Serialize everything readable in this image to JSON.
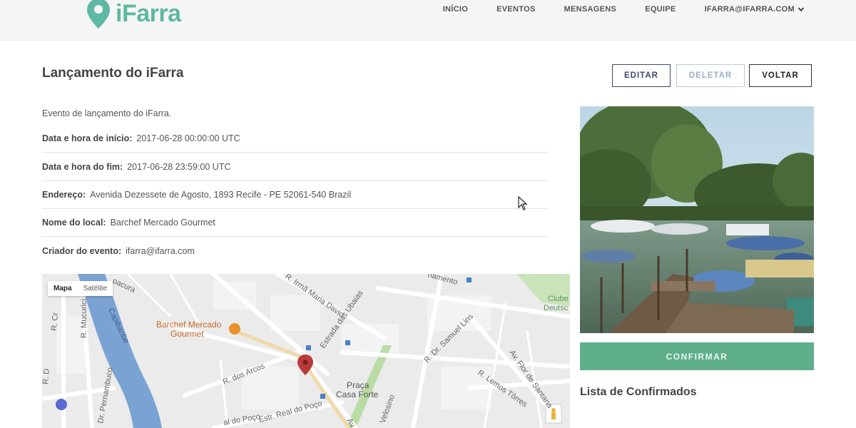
{
  "brand": {
    "name": "iFarra",
    "color": "#5fb8a3"
  },
  "nav": {
    "items": [
      "INÍCIO",
      "EVENTOS",
      "MENSAGENS",
      "EQUIPE"
    ],
    "account": "IFARRA@IFARRA.COM"
  },
  "event": {
    "title": "Lançamento do iFarra",
    "description": "Evento de lançamento do iFarra.",
    "fields": [
      {
        "label": "Data e hora de início:",
        "value": "2017-06-28 00:00:00 UTC"
      },
      {
        "label": "Data e hora do fim:",
        "value": "2017-06-28 23:59:00 UTC"
      },
      {
        "label": "Endereço:",
        "value": "Avenida Dezessete de Agosto, 1893 Recife - PE 52061-540 Brazil"
      },
      {
        "label": "Nome do local:",
        "value": "Barchef Mercado Gourmet"
      },
      {
        "label": "Criador do evento:",
        "value": "ifarra@ifarra.com"
      }
    ]
  },
  "actions": {
    "edit": "EDITAR",
    "delete": "DELETAR",
    "back": "VOLTAR",
    "confirm": "CONFIRMAR"
  },
  "map": {
    "toggle": [
      "Mapa",
      "Satélite"
    ],
    "labels": {
      "place1": "Barchef Mercado",
      "place2": "Gourmet",
      "praca1": "Praça",
      "praca2": "Casa Forte",
      "club1": "Clube",
      "club2": "Deutsc",
      "st1": "R. Irmã Maria David",
      "st2": "Estrada das Ubaias",
      "st3": "R. Dr. Samuel Lins",
      "st4": "R. dos Arcos",
      "st5": "Estr. Real do Poço",
      "st6": "R. Mucurici",
      "st7": "Dr. Pernambuco",
      "st8": "Av. Flor de Santana",
      "st9": "R. Lemos Tôrres",
      "st10": "Capibaribe",
      "st11": "Velosino",
      "st12": "pacura",
      "st13": "namento",
      "st14": "al do Poço",
      "st15": "R. Cr",
      "st16": "Av. D",
      "st17": "R. D"
    }
  },
  "confirmed_title": "Lista de Confirmados"
}
